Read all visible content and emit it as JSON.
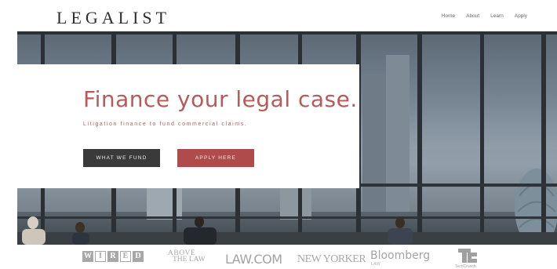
{
  "header": {
    "logo": "LEGALIST",
    "nav": [
      "Home",
      "About",
      "Learn",
      "Apply"
    ]
  },
  "hero": {
    "headline": "Finance your legal case.",
    "subhead": "Litigation finance to fund commercial claims.",
    "buttons": {
      "fund": "WHAT WE FUND",
      "apply": "APPLY HERE"
    }
  },
  "press": {
    "wired": [
      "W",
      "I",
      "R",
      "E",
      "D"
    ],
    "above_the_law": [
      "ABOVE",
      "THE LAW"
    ],
    "lawcom": "LAW.COM",
    "newyorker": "NEW YORKER",
    "bloomberg": "Bloomberg",
    "bloomberg_sub": "LAW",
    "techcrunch_sub": "TechCrunch"
  },
  "colors": {
    "accent": "#b85a5a",
    "button_dark": "#3a3a3a",
    "button_red": "#b04b4b",
    "logo_grey": "#a8a8a8"
  }
}
